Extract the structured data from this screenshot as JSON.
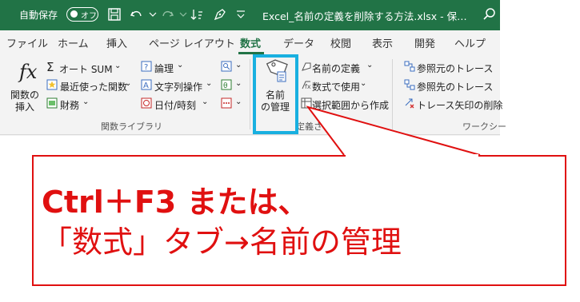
{
  "titlebar": {
    "autosave_label": "自動保存",
    "autosave_state": "オフ",
    "filename": "Excel_名前の定義を削除する方法.xlsx  -  保…",
    "colors": {
      "background": "#217346",
      "text": "#ffffff"
    }
  },
  "tabs": [
    {
      "label": "ファイル"
    },
    {
      "label": "ホーム"
    },
    {
      "label": "挿入"
    },
    {
      "label": "ページ レイアウト"
    },
    {
      "label": "数式",
      "active": true
    },
    {
      "label": "データ"
    },
    {
      "label": "校閲"
    },
    {
      "label": "表示"
    },
    {
      "label": "開発"
    },
    {
      "label": "ヘルプ"
    }
  ],
  "ribbon": {
    "insert_function": {
      "line1": "関数の",
      "line2": "挿入",
      "icon": "fx-icon"
    },
    "library": {
      "autosum": "オート SUM",
      "recent": "最近使った関数",
      "financial": "財務",
      "logical": "論理",
      "text": "文字列操作",
      "datetime": "日付/時刻",
      "group_label": "関数ライブラリ"
    },
    "name_manager": {
      "line1": "名前",
      "line2": "の管理",
      "icon": "tag-icon"
    },
    "defined_names": {
      "define_name": "名前の定義",
      "use_in_formula": "数式で使用",
      "create_from_selection": "選択範囲から作成",
      "group_label": "定義さ"
    },
    "auditing": {
      "trace_precedents": "参照元のトレース",
      "trace_dependents": "参照先のトレース",
      "remove_arrows": "トレース矢印の削除",
      "group_label": "ワークシー"
    }
  },
  "callout": {
    "line1": "Ctrl＋F3 または、",
    "line2": "「数式」タブ→名前の管理",
    "colors": {
      "accent": "#e01010",
      "highlight": "#19b0e0"
    }
  }
}
